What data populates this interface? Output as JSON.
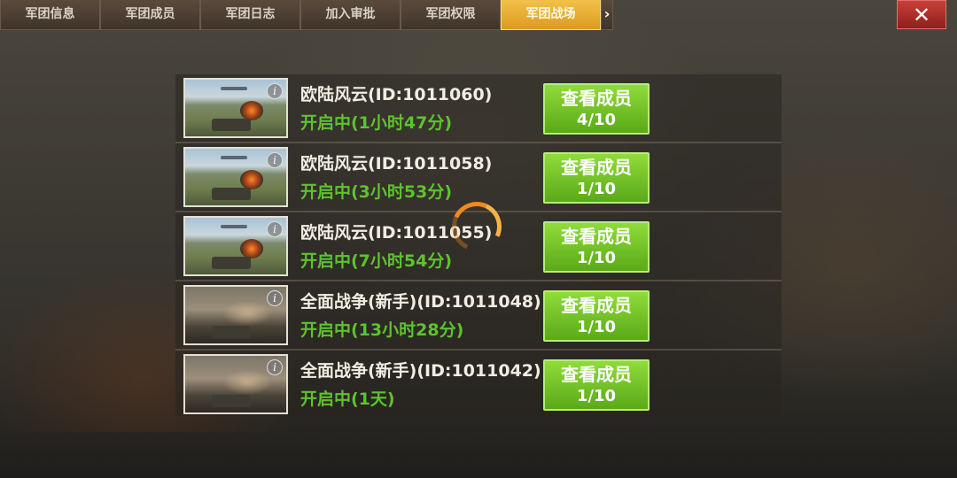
{
  "tabs": [
    {
      "label": "军团信息",
      "active": false
    },
    {
      "label": "军团成员",
      "active": false
    },
    {
      "label": "军团日志",
      "active": false
    },
    {
      "label": "加入审批",
      "active": false
    },
    {
      "label": "军团权限",
      "active": false
    },
    {
      "label": "军团战场",
      "active": true
    }
  ],
  "tab_more_icon": "chevron-right-icon",
  "close_icon": "close-icon",
  "close_glyph": "✕",
  "accent_color": "#e0a22a",
  "button_color": "#6ec224",
  "status_color": "#5ec22e",
  "battles": [
    {
      "title": "欧陆风云(ID:1011060)",
      "status": "开启中(1小时47分)",
      "button_label": "查看成员",
      "members": "4/10",
      "map": "euro"
    },
    {
      "title": "欧陆风云(ID:1011058)",
      "status": "开启中(3小时53分)",
      "button_label": "查看成员",
      "members": "1/10",
      "map": "euro"
    },
    {
      "title": "欧陆风云(ID:1011055)",
      "status": "开启中(7小时54分)",
      "button_label": "查看成员",
      "members": "1/10",
      "map": "euro"
    },
    {
      "title": "全面战争(新手)(ID:1011048)",
      "status": "开启中(13小时28分)",
      "button_label": "查看成员",
      "members": "1/10",
      "map": "war"
    },
    {
      "title": "全面战争(新手)(ID:1011042)",
      "status": "开启中(1天)",
      "button_label": "查看成员",
      "members": "1/10",
      "map": "war"
    }
  ],
  "info_glyph": "i"
}
